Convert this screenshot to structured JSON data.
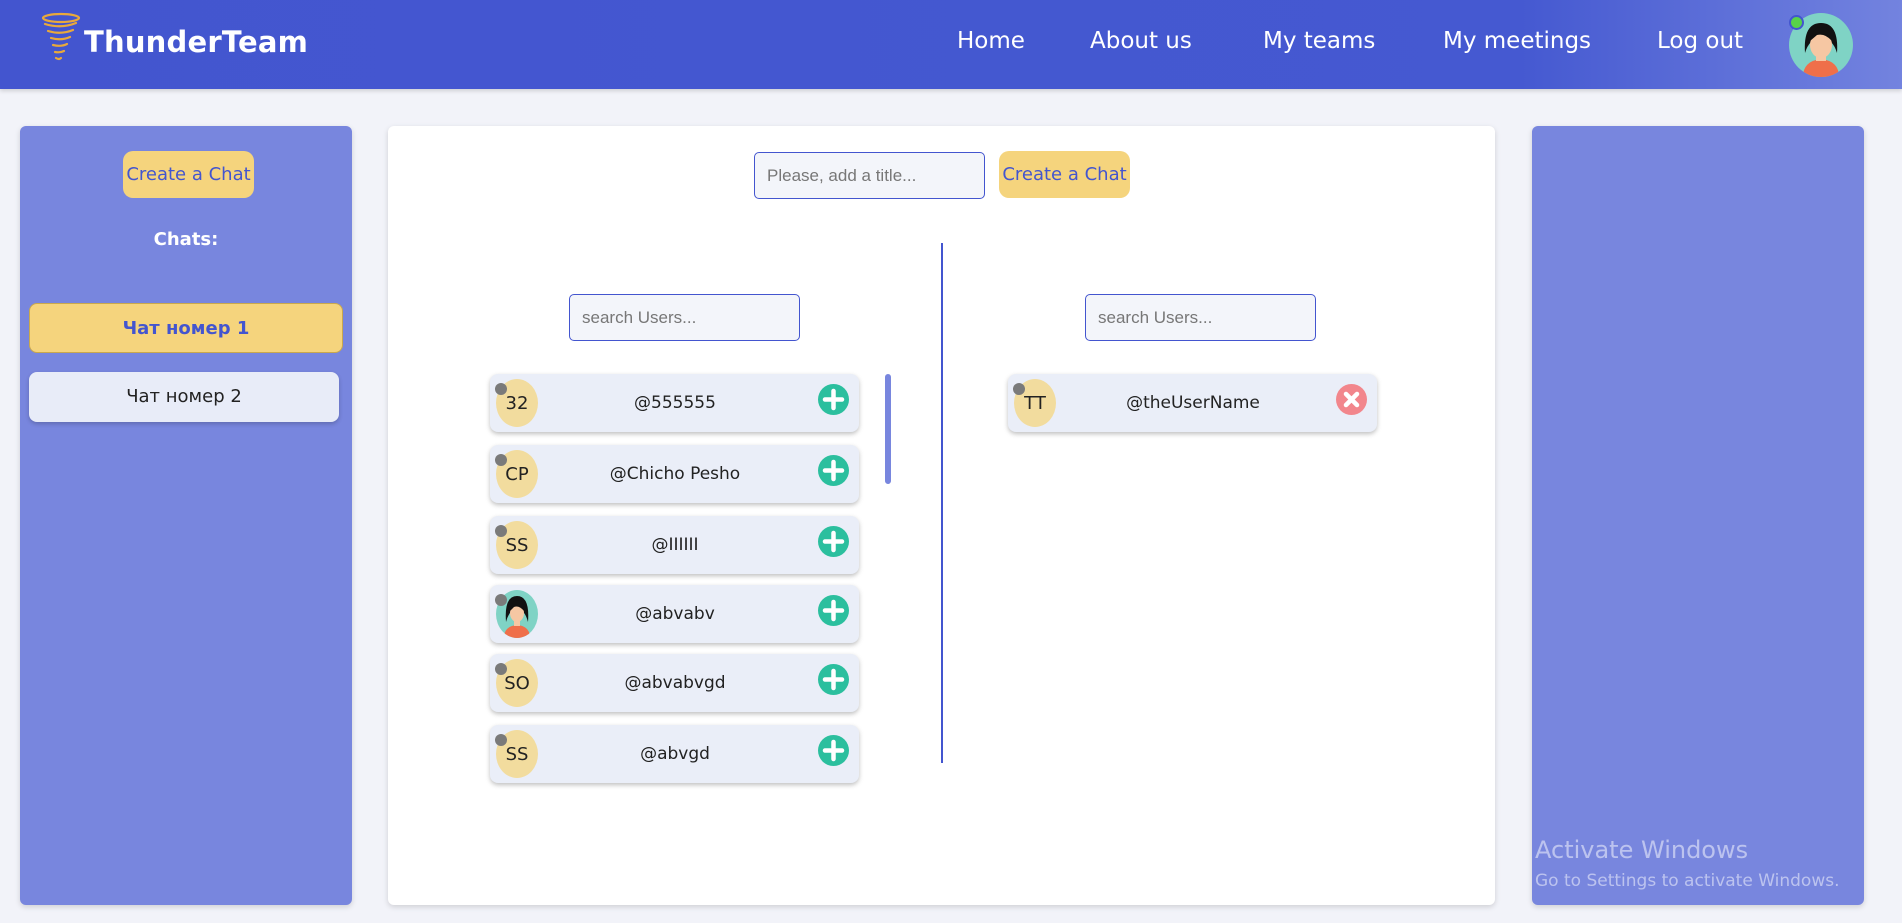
{
  "app": {
    "name": "ThunderTeam",
    "logo_icon": "tornado-icon"
  },
  "nav": {
    "links": [
      "Home",
      "About us",
      "My teams",
      "My meetings",
      "Log out"
    ],
    "avatar_icon": "user-avatar-icon",
    "online_status": "online"
  },
  "sidebar": {
    "create_label": "Create a Chat",
    "chats_label": "Chats:",
    "chats": [
      {
        "label": "Чат номер 1",
        "active": true
      },
      {
        "label": "Чат номер 2",
        "active": false
      }
    ]
  },
  "main": {
    "title_placeholder": "Please, add a title...",
    "create_label": "Create a Chat",
    "search_left_placeholder": "search Users...",
    "search_right_placeholder": "search Users...",
    "available_users": [
      {
        "initials": "32",
        "name": "@555555",
        "action": "add-icon"
      },
      {
        "initials": "CP",
        "name": "@Chicho Pesho",
        "action": "add-icon"
      },
      {
        "initials": "SS",
        "name": "@IIIIII",
        "action": "add-icon"
      },
      {
        "initials": "",
        "name": "@abvabv",
        "action": "add-icon",
        "has_photo": true
      },
      {
        "initials": "SO",
        "name": "@abvabvgd",
        "action": "add-icon"
      },
      {
        "initials": "SS",
        "name": "@abvgd",
        "action": "add-icon"
      }
    ],
    "selected_users": [
      {
        "initials": "TT",
        "name": "@theUserName",
        "action": "remove-icon"
      }
    ]
  },
  "watermark": {
    "title": "Activate Windows",
    "subtitle": "Go to Settings to activate Windows."
  },
  "colors": {
    "primary": "#4355cf",
    "panel": "#7886de",
    "accent_yellow": "#f5d47d",
    "add_green": "#2bbf9e",
    "remove_red": "#f2868c",
    "online_green": "#58d24a"
  }
}
